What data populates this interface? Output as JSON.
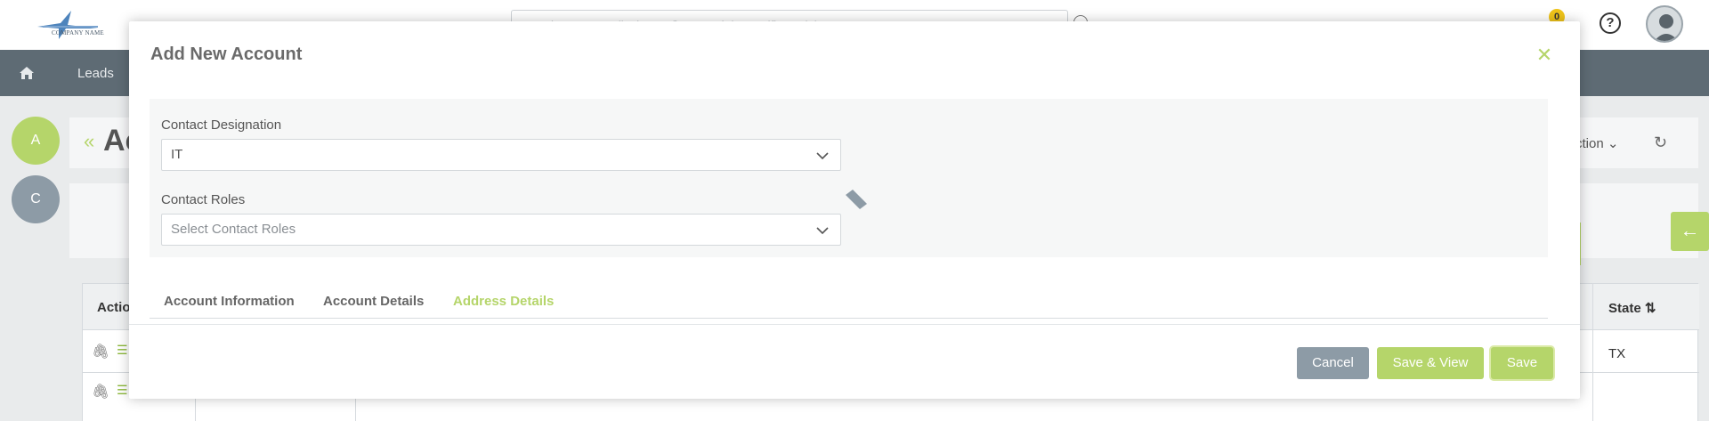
{
  "header": {
    "logo_text": "COMPANY NAME",
    "search_placeholder": "Search name, email, phone, @to search in specific module",
    "notification_count": "0"
  },
  "nav": {
    "leads_label": "Leads"
  },
  "background": {
    "circle_a": "A",
    "circle_c": "C",
    "page_title": "Ac",
    "action_label": "Action",
    "table": {
      "action_header": "Actio",
      "state_header": "State",
      "row1_state": "TX"
    }
  },
  "modal": {
    "title": "Add New Account",
    "contact_designation_label": "Contact Designation",
    "contact_designation_value": "IT",
    "contact_roles_label": "Contact Roles",
    "contact_roles_placeholder": "Select Contact Roles",
    "tabs": [
      {
        "label": "Account Information",
        "active": false
      },
      {
        "label": "Account Details",
        "active": false
      },
      {
        "label": "Address Details",
        "active": true
      }
    ],
    "buttons": {
      "cancel": "Cancel",
      "save_view": "Save & View",
      "save": "Save"
    }
  },
  "colors": {
    "accent": "#b5d56a",
    "nav_bg": "#5e6b74",
    "cancel_bg": "#8d9ba6"
  }
}
